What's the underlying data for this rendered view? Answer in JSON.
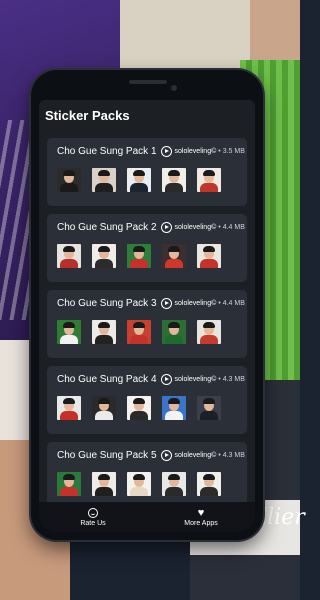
{
  "header": {
    "title": "Sticker Packs"
  },
  "packs": [
    {
      "title": "Cho Gue Sung Pack 1",
      "author": "sololeveling©",
      "size": "3.5 MB",
      "thumbs": [
        {
          "bg": "#2b2b2b",
          "body": "#1a1a1a"
        },
        {
          "bg": "#d8d2c8",
          "body": "#1f1f1f"
        },
        {
          "bg": "#e9eef3",
          "body": "#1c2433"
        },
        {
          "bg": "#f1eee8",
          "body": "#2a2a2a"
        },
        {
          "bg": "#f0e9e4",
          "body": "#c3342c"
        }
      ]
    },
    {
      "title": "Cho Gue Sung Pack 2",
      "author": "sololeveling©",
      "size": "4.4 MB",
      "thumbs": [
        {
          "bg": "#e6e3de",
          "body": "#b9302a"
        },
        {
          "bg": "#f0ede8",
          "body": "#2c2c2c"
        },
        {
          "bg": "#2e7d3a",
          "body": "#c9302a"
        },
        {
          "bg": "#3b2f2f",
          "body": "#d0352e"
        },
        {
          "bg": "#eae6e0",
          "body": "#c4322b"
        }
      ]
    },
    {
      "title": "Cho Gue Sung Pack 3",
      "author": "sololeveling©",
      "size": "4.4 MB",
      "thumbs": [
        {
          "bg": "#2f7d33",
          "body": "#f2f2f2"
        },
        {
          "bg": "#ecebe7",
          "body": "#222"
        },
        {
          "bg": "#c8402f",
          "body": "#c4322b"
        },
        {
          "bg": "#2c6e35",
          "body": "#1e6b2c"
        },
        {
          "bg": "#e8e4de",
          "body": "#c73a2f"
        }
      ]
    },
    {
      "title": "Cho Gue Sung Pack 4",
      "author": "sololeveling©",
      "size": "4.3 MB",
      "thumbs": [
        {
          "bg": "#e9e9e9",
          "body": "#c73028"
        },
        {
          "bg": "#2a2a2a",
          "body": "#eaeaea"
        },
        {
          "bg": "#f4f2ef",
          "body": "#2a2a2a"
        },
        {
          "bg": "#3a76c8",
          "body": "#f3f3f3"
        },
        {
          "bg": "#3b3f4a",
          "body": "#1d1f26"
        }
      ]
    },
    {
      "title": "Cho Gue Sung Pack 5",
      "author": "sololeveling©",
      "size": "4.3 MB",
      "thumbs": [
        {
          "bg": "#2c7a3a",
          "body": "#c9302a"
        },
        {
          "bg": "#efece8",
          "body": "#1f1f1f"
        },
        {
          "bg": "#f3f1ee",
          "body": "#e7d8c4"
        },
        {
          "bg": "#e8e8e8",
          "body": "#2a2a2a"
        },
        {
          "bg": "#f2eee9",
          "body": "#2b2b2b"
        }
      ]
    }
  ],
  "bottom_nav": {
    "rate_label": "Rate Us",
    "rate_icon": "smile-icon",
    "more_label": "More Apps",
    "more_icon": "heart-icon"
  },
  "background": {
    "cap_text": "Collier"
  }
}
